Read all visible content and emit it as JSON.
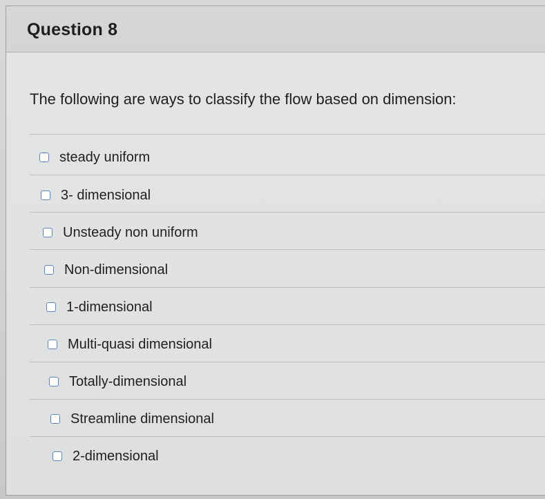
{
  "question": {
    "title": "Question 8",
    "prompt": "The following are ways to classify the flow based on dimension:",
    "options": [
      {
        "label": "steady uniform",
        "checked": false
      },
      {
        "label": "3- dimensional",
        "checked": false
      },
      {
        "label": "Unsteady non uniform",
        "checked": false
      },
      {
        "label": "Non-dimensional",
        "checked": false
      },
      {
        "label": "1-dimensional",
        "checked": false
      },
      {
        "label": "Multi-quasi dimensional",
        "checked": false
      },
      {
        "label": "Totally-dimensional",
        "checked": false
      },
      {
        "label": "Streamline dimensional",
        "checked": false
      },
      {
        "label": "2-dimensional",
        "checked": false
      }
    ]
  },
  "colors": {
    "checkbox_border": "#5a84c7",
    "text": "#1f1f1f"
  }
}
